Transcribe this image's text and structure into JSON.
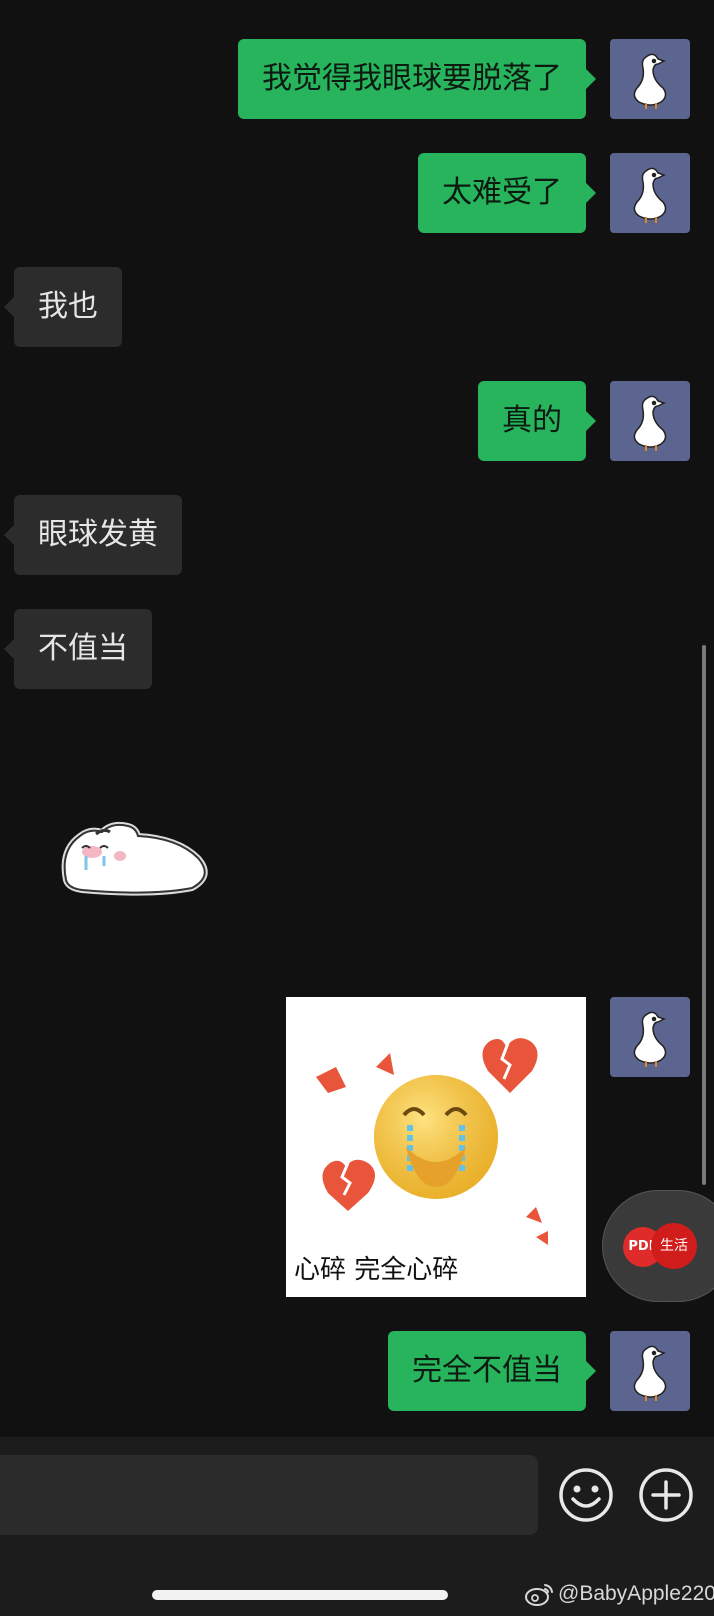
{
  "messages": [
    {
      "side": "out",
      "type": "text",
      "text": "我觉得我眼球要脱落了"
    },
    {
      "side": "out",
      "type": "text",
      "text": "太难受了"
    },
    {
      "side": "in",
      "type": "text",
      "text": "我也"
    },
    {
      "side": "out",
      "type": "text",
      "text": "真的"
    },
    {
      "side": "in",
      "type": "text",
      "text": "眼球发黄"
    },
    {
      "side": "in",
      "type": "text",
      "text": "不值当"
    },
    {
      "side": "in",
      "type": "sticker",
      "sticker": "crying-bunny-sticker"
    },
    {
      "side": "out",
      "type": "image",
      "caption": "心碎 完全心碎"
    },
    {
      "side": "out",
      "type": "text",
      "text": "完全不值当"
    }
  ],
  "float_widget": {
    "pdf_label": "PDF",
    "stamp_label": "生活"
  },
  "input_bar": {
    "emoji_icon": "emoji-icon",
    "add_icon": "plus-circle-icon"
  },
  "watermark": {
    "icon": "weibo-icon",
    "text": "@BabyApple220"
  },
  "colors": {
    "outgoing_bubble": "#27b45c",
    "incoming_bubble": "#2c2c2c",
    "background": "#111111",
    "avatar_bg": "#5c6590"
  }
}
